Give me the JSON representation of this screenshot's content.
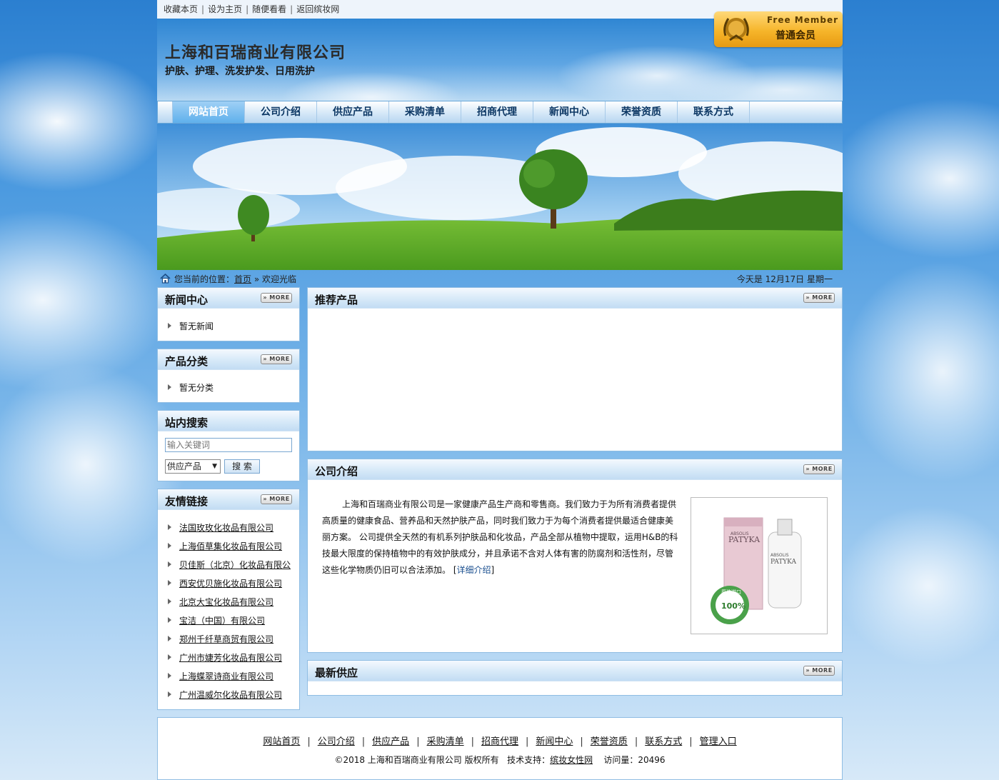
{
  "topbar": {
    "links": [
      "收藏本页",
      "设为主页",
      "随便看看",
      "返回缤妆网"
    ]
  },
  "header": {
    "company_name": "上海和百瑞商业有限公司",
    "tagline": "护肤、护理、洗发护发、日用洗护",
    "member_en": "Free Member",
    "member_cn": "普通会员"
  },
  "nav": {
    "items": [
      "网站首页",
      "公司介绍",
      "供应产品",
      "采购清单",
      "招商代理",
      "新闻中心",
      "荣誉资质",
      "联系方式"
    ],
    "active_index": 0
  },
  "breadcrumb": {
    "prefix": "您当前的位置：",
    "home": "首页",
    "separator": "»",
    "current": "欢迎光临",
    "date": "今天是 12月17日 星期一"
  },
  "more_label": "MORE",
  "sidebar": {
    "news": {
      "title": "新闻中心",
      "items": [
        "暂无新闻"
      ]
    },
    "categories": {
      "title": "产品分类",
      "items": [
        "暂无分类"
      ]
    },
    "search": {
      "title": "站内搜索",
      "placeholder": "输入关键词",
      "select_value": "供应产品",
      "button": "搜 索"
    },
    "links": {
      "title": "友情链接",
      "items": [
        "法国玫玫化妆品有限公司",
        "上海佰草集化妆品有限公司",
        "贝佳斯（北京）化妆品有限公",
        "西安优贝施化妆品有限公司",
        "北京大宝化妆品有限公司",
        "宝洁（中国）有限公司",
        "郑州千纤草商贸有限公司",
        "广州市婕芳化妆品有限公司",
        "上海蝶翠诗商业有限公司",
        "广州温威尔化妆品有限公司"
      ]
    }
  },
  "main": {
    "recommended": {
      "title": "推荐产品"
    },
    "about": {
      "title": "公司介绍",
      "text": "上海和百瑞商业有限公司是一家健康产品生产商和零售商。我们致力于为所有消费者提供高质量的健康食品、营养品和天然护肤产品，同时我们致力于为每个消费者提供最适合健康美丽方案。 公司提供全天然的有机系列护肤品和化妆品，产品全部从植物中提取，运用H&B的科技最大限度的保持植物中的有效护肤成分，并且承诺不含对人体有害的防腐剂和活性剂，尽管这些化学物质仍旧可以合法添加。",
      "detail_link": "详细介绍",
      "product_brand": "PATYKA",
      "product_brand_small": "ABSOLIS",
      "badge_text": "原装进口",
      "badge_pct": "100%"
    },
    "latest": {
      "title": "最新供应"
    }
  },
  "footer": {
    "links": [
      "网站首页",
      "公司介绍",
      "供应产品",
      "采购清单",
      "招商代理",
      "新闻中心",
      "荣誉资质",
      "联系方式",
      "管理入口"
    ],
    "copyright": "©2018 上海和百瑞商业有限公司 版权所有",
    "tech_label": "技术支持：",
    "tech_link": "缤妆女性网",
    "visits_label": "访问量：",
    "visits": "20496"
  }
}
